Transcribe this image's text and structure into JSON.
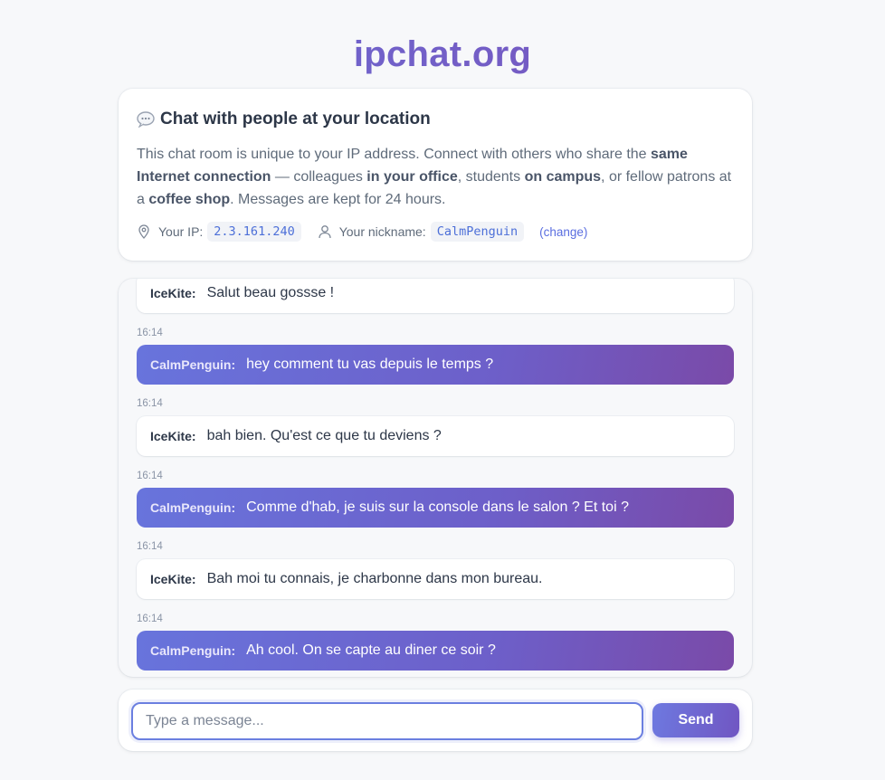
{
  "site": {
    "title": "ipchat.org"
  },
  "info": {
    "heading": "Chat with people at your location",
    "desc_parts": [
      "This chat room is unique to your IP address. Connect with others who share the ",
      "same Internet connection",
      " — colleagues ",
      "in your office",
      ", students ",
      "on campus",
      ", or fellow patrons at a ",
      "coffee shop",
      ". Messages are kept for 24 hours."
    ],
    "ip_label": "Your IP:",
    "ip_value": "2.3.161.240",
    "nickname_label": "Your nickname:",
    "nickname_value": "CalmPenguin",
    "change_label": "(change)"
  },
  "messages": [
    {
      "author": "IceKite:",
      "text": "Salut beau gossse !",
      "time": "",
      "mine": false
    },
    {
      "author": "CalmPenguin:",
      "text": "hey comment tu vas depuis le temps ?",
      "time": "16:14",
      "mine": true
    },
    {
      "author": "IceKite:",
      "text": "bah bien. Qu'est ce que tu deviens ?",
      "time": "16:14",
      "mine": false
    },
    {
      "author": "CalmPenguin:",
      "text": "Comme d'hab, je suis sur la console dans le salon ? Et toi ?",
      "time": "16:14",
      "mine": true
    },
    {
      "author": "IceKite:",
      "text": "Bah moi tu connais, je charbonne dans mon bureau.",
      "time": "16:14",
      "mine": false
    },
    {
      "author": "CalmPenguin:",
      "text": "Ah cool. On se capte au diner ce soir ?",
      "time": "16:14",
      "mine": true
    }
  ],
  "compose": {
    "placeholder": "Type a message...",
    "send_label": "Send"
  },
  "colors": {
    "accent": "#6b6fd6",
    "accent_dark": "#7a4aa8",
    "link": "#5a6ee0"
  }
}
